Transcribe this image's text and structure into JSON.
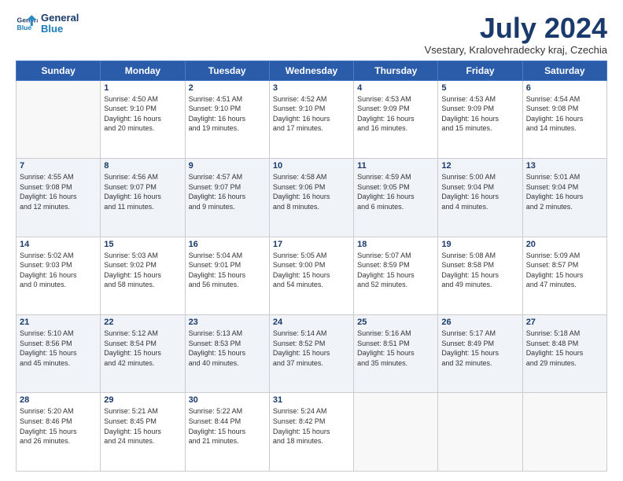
{
  "logo": {
    "line1": "General",
    "line2": "Blue"
  },
  "title": "July 2024",
  "location": "Vsestary, Kralovehradecky kraj, Czechia",
  "headers": [
    "Sunday",
    "Monday",
    "Tuesday",
    "Wednesday",
    "Thursday",
    "Friday",
    "Saturday"
  ],
  "rows": [
    [
      {
        "day": "",
        "content": ""
      },
      {
        "day": "1",
        "content": "Sunrise: 4:50 AM\nSunset: 9:10 PM\nDaylight: 16 hours\nand 20 minutes."
      },
      {
        "day": "2",
        "content": "Sunrise: 4:51 AM\nSunset: 9:10 PM\nDaylight: 16 hours\nand 19 minutes."
      },
      {
        "day": "3",
        "content": "Sunrise: 4:52 AM\nSunset: 9:10 PM\nDaylight: 16 hours\nand 17 minutes."
      },
      {
        "day": "4",
        "content": "Sunrise: 4:53 AM\nSunset: 9:09 PM\nDaylight: 16 hours\nand 16 minutes."
      },
      {
        "day": "5",
        "content": "Sunrise: 4:53 AM\nSunset: 9:09 PM\nDaylight: 16 hours\nand 15 minutes."
      },
      {
        "day": "6",
        "content": "Sunrise: 4:54 AM\nSunset: 9:08 PM\nDaylight: 16 hours\nand 14 minutes."
      }
    ],
    [
      {
        "day": "7",
        "content": "Sunrise: 4:55 AM\nSunset: 9:08 PM\nDaylight: 16 hours\nand 12 minutes."
      },
      {
        "day": "8",
        "content": "Sunrise: 4:56 AM\nSunset: 9:07 PM\nDaylight: 16 hours\nand 11 minutes."
      },
      {
        "day": "9",
        "content": "Sunrise: 4:57 AM\nSunset: 9:07 PM\nDaylight: 16 hours\nand 9 minutes."
      },
      {
        "day": "10",
        "content": "Sunrise: 4:58 AM\nSunset: 9:06 PM\nDaylight: 16 hours\nand 8 minutes."
      },
      {
        "day": "11",
        "content": "Sunrise: 4:59 AM\nSunset: 9:05 PM\nDaylight: 16 hours\nand 6 minutes."
      },
      {
        "day": "12",
        "content": "Sunrise: 5:00 AM\nSunset: 9:04 PM\nDaylight: 16 hours\nand 4 minutes."
      },
      {
        "day": "13",
        "content": "Sunrise: 5:01 AM\nSunset: 9:04 PM\nDaylight: 16 hours\nand 2 minutes."
      }
    ],
    [
      {
        "day": "14",
        "content": "Sunrise: 5:02 AM\nSunset: 9:03 PM\nDaylight: 16 hours\nand 0 minutes."
      },
      {
        "day": "15",
        "content": "Sunrise: 5:03 AM\nSunset: 9:02 PM\nDaylight: 15 hours\nand 58 minutes."
      },
      {
        "day": "16",
        "content": "Sunrise: 5:04 AM\nSunset: 9:01 PM\nDaylight: 15 hours\nand 56 minutes."
      },
      {
        "day": "17",
        "content": "Sunrise: 5:05 AM\nSunset: 9:00 PM\nDaylight: 15 hours\nand 54 minutes."
      },
      {
        "day": "18",
        "content": "Sunrise: 5:07 AM\nSunset: 8:59 PM\nDaylight: 15 hours\nand 52 minutes."
      },
      {
        "day": "19",
        "content": "Sunrise: 5:08 AM\nSunset: 8:58 PM\nDaylight: 15 hours\nand 49 minutes."
      },
      {
        "day": "20",
        "content": "Sunrise: 5:09 AM\nSunset: 8:57 PM\nDaylight: 15 hours\nand 47 minutes."
      }
    ],
    [
      {
        "day": "21",
        "content": "Sunrise: 5:10 AM\nSunset: 8:56 PM\nDaylight: 15 hours\nand 45 minutes."
      },
      {
        "day": "22",
        "content": "Sunrise: 5:12 AM\nSunset: 8:54 PM\nDaylight: 15 hours\nand 42 minutes."
      },
      {
        "day": "23",
        "content": "Sunrise: 5:13 AM\nSunset: 8:53 PM\nDaylight: 15 hours\nand 40 minutes."
      },
      {
        "day": "24",
        "content": "Sunrise: 5:14 AM\nSunset: 8:52 PM\nDaylight: 15 hours\nand 37 minutes."
      },
      {
        "day": "25",
        "content": "Sunrise: 5:16 AM\nSunset: 8:51 PM\nDaylight: 15 hours\nand 35 minutes."
      },
      {
        "day": "26",
        "content": "Sunrise: 5:17 AM\nSunset: 8:49 PM\nDaylight: 15 hours\nand 32 minutes."
      },
      {
        "day": "27",
        "content": "Sunrise: 5:18 AM\nSunset: 8:48 PM\nDaylight: 15 hours\nand 29 minutes."
      }
    ],
    [
      {
        "day": "28",
        "content": "Sunrise: 5:20 AM\nSunset: 8:46 PM\nDaylight: 15 hours\nand 26 minutes."
      },
      {
        "day": "29",
        "content": "Sunrise: 5:21 AM\nSunset: 8:45 PM\nDaylight: 15 hours\nand 24 minutes."
      },
      {
        "day": "30",
        "content": "Sunrise: 5:22 AM\nSunset: 8:44 PM\nDaylight: 15 hours\nand 21 minutes."
      },
      {
        "day": "31",
        "content": "Sunrise: 5:24 AM\nSunset: 8:42 PM\nDaylight: 15 hours\nand 18 minutes."
      },
      {
        "day": "",
        "content": ""
      },
      {
        "day": "",
        "content": ""
      },
      {
        "day": "",
        "content": ""
      }
    ]
  ]
}
